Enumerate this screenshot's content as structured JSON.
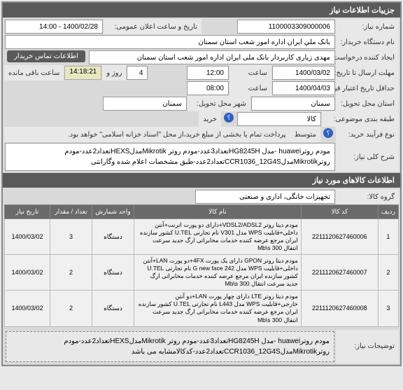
{
  "header1": "جزییات اطلاعات نیاز",
  "labels": {
    "need_no": "شماره نیاز:",
    "public_time": "تاریخ و ساعت اعلان عمومی:",
    "org_name": "نام دستگاه خریدار:",
    "creator": "ایجاد کننده درخواست:",
    "send_deadline": "مهلت ارسال تا تاریخ:",
    "hour": "ساعت",
    "day_and": "روز و",
    "remaining": "ساعت باقی مانده",
    "validity": "حداقل تاریخ اعتبار قیمت:",
    "delivery_place": "استان محل تحویل:",
    "delivery_city": "شهر محل تحویل:",
    "need_cat": "طبقه بندی موضوعی:",
    "buy_type": "نوع فرآیند خرید:",
    "overall_title": "شرح کلی نیاز:",
    "group": "گروه کالا:",
    "notes": "توضیحات نیاز:"
  },
  "values": {
    "need_no": "1100003309000006",
    "public_time": "1400/02/28 - 14:00",
    "org_name": "بانک ملي ايران اداره امور شعب استان سمنان",
    "creator": "مهدی زیاری کاربردار بانک ملی ایران اداره امور شعب استان سمنان",
    "contact_btn": "اطلاعات تماس خریدار",
    "send_date": "1400/03/02",
    "send_time": "12:00",
    "days_left": "4",
    "time_left": "14:18:21",
    "validity_date": "1400/04/03",
    "validity_time": "08:00",
    "delivery_province": "سمنان",
    "delivery_city": "سمنان",
    "need_cat": "کالا",
    "cat_icon_label": "خرید",
    "buy_type_text": "پرداخت تمام یا بخشی از مبلغ خرید،از محل \"اسناد خزانه اسلامی\" خواهد بود.",
    "buy_icon_label": "متوسط",
    "overall_title_text": "مودم روترhuawei -مدل HG8245Hتعداد3عدد-مودم روتر MikrotikمدلHEXSتعداد2عدد-مودم روترMikrotikمدلCCR1036_12G4Sتعداد2عدد-طبق مشخصات اعلام شده وگارانتی",
    "group": "تجهیزات خانگی، اداری و صنعتی",
    "notes_text": "مودم روترhuawei -مدل HG8245Hتعداد3عدد-مودم روتر MikrotikمدلHEXSتعداد2عدد-مودم روترMikrotikمدلCCR1036_12G4Sتعداد2عدد-کدکالامشابه می باشد"
  },
  "header2": "اطلاعات کالاهای مورد نیاز",
  "table": {
    "cols": [
      "ردیف",
      "کد کالا",
      "نام کالا",
      "واحد شمارش",
      "تعداد / مقدار",
      "تاریخ نیاز"
    ],
    "rows": [
      {
        "idx": "1",
        "code": "2211120627460006",
        "desc": "مودم دیتا روتر VDSL2/ADSL2+دارای دو پورت اترنت+آنتن داخلی+قابلیت WPS مدل V301 نام تجارتی U.TEL کشور سازنده ایران مرجع عرضه کننده خدمات مخابراتی ارگ جدید سرعت انتقال 300 Mb\\s",
        "unit": "دستگاه",
        "qty": "3",
        "date": "1400/03/02"
      },
      {
        "idx": "2",
        "code": "2211120627460007",
        "desc": "مودم دیتا روتر GPON دارای یک پورت 4FX+دو پورت LAN+آنتن داخلی+قابلیت WPS مدل G new face 242 نام تجارتی U.TEL کشور سازنده ایران مرجع عرضه کننده خدمات مخابراتی ارگ جدید سرعت انتقال 300 Mb\\s",
        "unit": "دستگاه",
        "qty": "2",
        "date": "1400/03/02"
      },
      {
        "idx": "3",
        "code": "2211120627460008",
        "desc": "مودم دیتا روتر LTE دارای چهار پورت LAN+دو آنتن خارجی+قابلیت WPS مدل L443 نام تجارتی U.TEL کشور سازنده ایران مرجع عرضه کننده خدمات مخابراتی ارگ جدید سرعت انتقال 300 Mb\\s",
        "unit": "دستگاه",
        "qty": "2",
        "date": "1400/03/02"
      }
    ]
  }
}
